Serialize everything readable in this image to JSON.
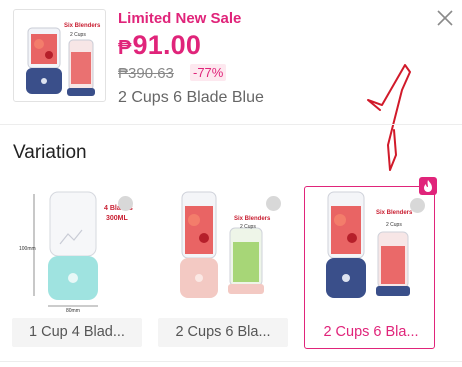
{
  "product": {
    "promo_label": "Limited New Sale",
    "currency": "₱",
    "price": "91.00",
    "original_price": "₱390.63",
    "discount": "-77%",
    "selected_variant": "2 Cups 6 Blade Blue"
  },
  "variation": {
    "title": "Variation",
    "options": [
      {
        "label": "1 Cup 4 Blad...",
        "image_text": [
          "4 Blades",
          "300ML"
        ],
        "side": "100mm",
        "bottom": "80mm"
      },
      {
        "label": "2 Cups 6 Bla...",
        "image_text": [
          "Six Blenders",
          "2 Cups"
        ]
      },
      {
        "label": "2 Cups 6 Bla...",
        "image_text": [
          "Six Blenders",
          "2 Cups"
        ]
      }
    ]
  },
  "thumb_text": [
    "Six Blenders",
    "2 Cups"
  ],
  "colors": {
    "accent": "#e0247a",
    "blue_base": "#3a4f8a",
    "pink_base": "#f3c9c3",
    "teal_base": "#9fe3e0"
  }
}
